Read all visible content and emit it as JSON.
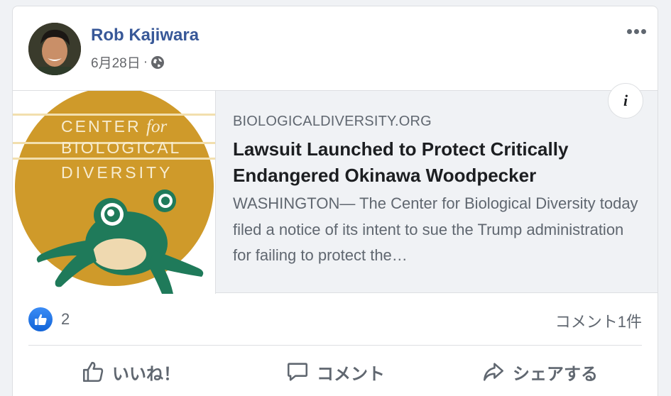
{
  "post": {
    "author": "Rob Kajiwara",
    "date": "6月28日",
    "separator": "·",
    "privacy_icon": "globe-icon",
    "menu_icon": "more-options-icon"
  },
  "link_preview": {
    "image_logo_lines": [
      "CENTER",
      "for",
      "BIOLOGICAL",
      "DIVERSITY"
    ],
    "domain": "BIOLOGICALDIVERSITY.ORG",
    "title": "Lawsuit Launched to Protect Critically Endangered Okinawa Woodpecker",
    "description": "WASHINGTON— The Center for Biological Diversity today filed a notice of its intent to sue the Trump administration for failing to protect the…",
    "info_icon_label": "i"
  },
  "reactions": {
    "icon": "like-reaction-icon",
    "count": "2",
    "comments": "コメント1件"
  },
  "actions": {
    "like": "いいね！",
    "comment": "コメント",
    "share": "シェアする"
  },
  "colors": {
    "author": "#385898",
    "logo_gold": "#cf9a2a",
    "frog_green": "#1f7a5a",
    "like_blue": "#1877f2"
  }
}
